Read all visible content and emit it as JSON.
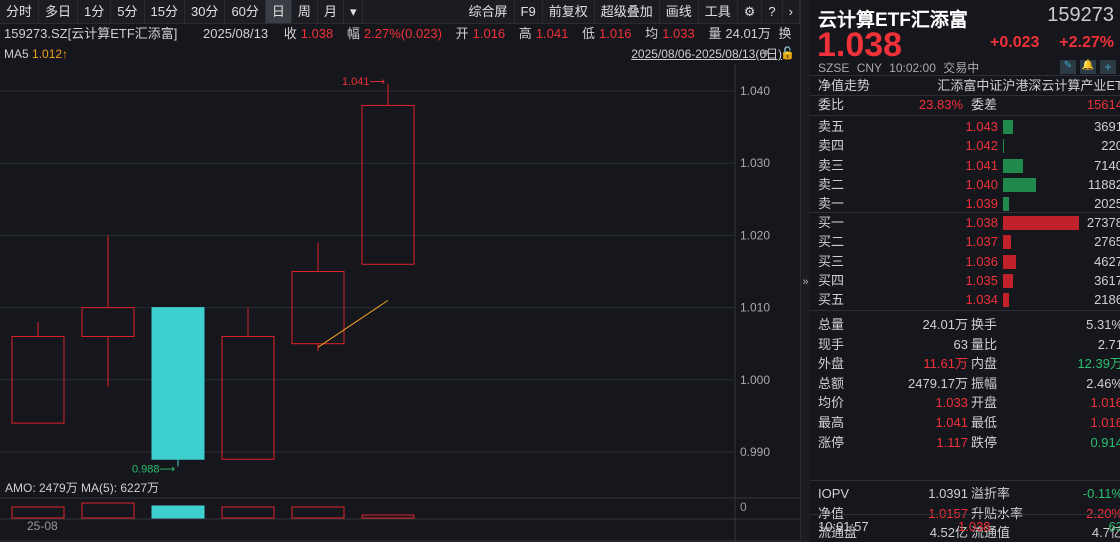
{
  "toolbar": {
    "left": [
      "分时",
      "多日",
      "1分",
      "5分",
      "15分",
      "30分",
      "60分",
      "日",
      "周",
      "月",
      "▾"
    ],
    "active": "日",
    "right": [
      "综合屏",
      "F9",
      "前复权",
      "超级叠加",
      "画线",
      "工具"
    ]
  },
  "info": {
    "code": "159273.SZ[云计算ETF汇添富]",
    "date": "2025/08/13",
    "close_label": "收",
    "close": "1.038",
    "amp_label": "幅",
    "amp": "2.27%(0.023)",
    "open_label": "开",
    "open": "1.016",
    "high_label": "高",
    "high": "1.041",
    "low_label": "低",
    "low": "1.016",
    "avg_label": "均",
    "avg": "1.033",
    "vol_label": "量",
    "vol": "24.01万",
    "more": "换"
  },
  "ma": {
    "label": "MA5",
    "value": "1.012↑"
  },
  "range": "2025/08/06-2025/08/13(6日)",
  "amo": "AMO: 2479万 MA(5): 6227万",
  "vol_axis": "0",
  "x_label": "25-08",
  "chart_data": {
    "type": "candlestick",
    "yticks": [
      "1.040",
      "1.030",
      "1.020",
      "1.010",
      "1.000",
      "0.990"
    ],
    "ylim": [
      0.985,
      1.046
    ],
    "candles": [
      {
        "o": 0.994,
        "c": 1.006,
        "h": 1.008,
        "l": 0.994
      },
      {
        "o": 1.006,
        "c": 1.01,
        "h": 1.02,
        "l": 0.999
      },
      {
        "o": 1.01,
        "c": 0.989,
        "h": 1.01,
        "l": 0.988
      },
      {
        "o": 0.989,
        "c": 1.006,
        "h": 1.01,
        "l": 0.989
      },
      {
        "o": 1.005,
        "c": 1.015,
        "h": 1.019,
        "l": 1.004
      },
      {
        "o": 1.016,
        "c": 1.038,
        "h": 1.041,
        "l": 1.016
      }
    ],
    "ma5": [
      null,
      null,
      null,
      null,
      1.0045,
      1.011
    ],
    "high_label": "1.041",
    "low_label": "0.988",
    "volume_rel": [
      0.55,
      0.75,
      0.6,
      0.55,
      0.55,
      0.15
    ]
  },
  "quote": {
    "name": "云计算ETF汇添富",
    "code": "159273",
    "price": "1.038",
    "change": "+0.023",
    "pct": "+2.27%",
    "exchange": "SZSE",
    "currency": "CNY",
    "time": "10:02:00",
    "status": "交易中",
    "nav_label": "净值走势",
    "full_name": "汇添富中证沪港深云计算产业ET"
  },
  "ratio": {
    "label": "委比",
    "value": "23.83%",
    "diff_label": "委差",
    "diff": "15614"
  },
  "asks": [
    {
      "label": "卖五",
      "price": "1.043",
      "vol": "3691",
      "n": 3691
    },
    {
      "label": "卖四",
      "price": "1.042",
      "vol": "220",
      "n": 220
    },
    {
      "label": "卖三",
      "price": "1.041",
      "vol": "7140",
      "n": 7140
    },
    {
      "label": "卖二",
      "price": "1.040",
      "vol": "11882",
      "n": 11882
    },
    {
      "label": "卖一",
      "price": "1.039",
      "vol": "2025",
      "n": 2025
    }
  ],
  "bids": [
    {
      "label": "买一",
      "price": "1.038",
      "vol": "27378",
      "n": 27378
    },
    {
      "label": "买二",
      "price": "1.037",
      "vol": "2765",
      "n": 2765
    },
    {
      "label": "买三",
      "price": "1.036",
      "vol": "4627",
      "n": 4627
    },
    {
      "label": "买四",
      "price": "1.035",
      "vol": "3617",
      "n": 3617
    },
    {
      "label": "买五",
      "price": "1.034",
      "vol": "2186",
      "n": 2186
    }
  ],
  "stats": [
    [
      "总量",
      "24.01万",
      "",
      "换手",
      "5.31%",
      ""
    ],
    [
      "现手",
      "63",
      "",
      "量比",
      "2.71",
      ""
    ],
    [
      "外盘",
      "11.61万",
      "red",
      "内盘",
      "12.39万",
      "green"
    ],
    [
      "总额",
      "2479.17万",
      "",
      "振幅",
      "2.46%",
      ""
    ],
    [
      "均价",
      "1.033",
      "red",
      "开盘",
      "1.016",
      "red"
    ],
    [
      "最高",
      "1.041",
      "red",
      "最低",
      "1.016",
      "red"
    ],
    [
      "涨停",
      "1.117",
      "red",
      "跌停",
      "0.914",
      "green"
    ]
  ],
  "stats2": [
    [
      "IOPV",
      "1.0391",
      "",
      "溢折率",
      "-0.11%",
      "green"
    ],
    [
      "净值",
      "1.0157",
      "red",
      "升贴水率",
      "2.20%",
      "red"
    ],
    [
      "流通盘",
      "4.52亿",
      "",
      "流通值",
      "4.7亿",
      ""
    ]
  ],
  "tick": {
    "time": "10:01:57",
    "price": "1.038",
    "vol": "63"
  }
}
